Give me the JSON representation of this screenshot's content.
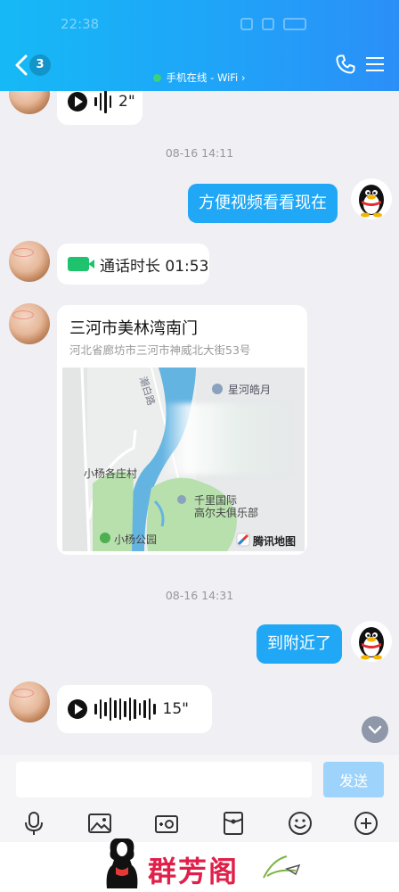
{
  "status_bar": {
    "time": "22:38"
  },
  "header": {
    "unread_count": "3",
    "online_status": "手机在线 - WiFi",
    "online_chevron": "›"
  },
  "messages": {
    "voice_1_duration": "2\"",
    "time_1": "08-16 14:11",
    "out_1": "方便视频看看现在",
    "call_text": "通话时长 01:53",
    "location_title": "三河市美林湾南门",
    "location_address": "河北省廊坊市三河市神威北大街53号",
    "map_labels": {
      "star": "星河皓月",
      "road": "潮白路",
      "village": "小杨各庄村",
      "golf_1": "千里国际",
      "golf_2": "高尔夫俱乐部",
      "park": "小杨公园",
      "provider": "腾讯地图"
    },
    "time_2": "08-16 14:31",
    "out_2": "到附近了",
    "voice_2_duration": "15\""
  },
  "input": {
    "placeholder": "",
    "send_label": "发送"
  },
  "toolbar_icons": [
    "microphone-icon",
    "image-icon",
    "camera-icon",
    "red-packet-icon",
    "emoji-icon",
    "plus-icon"
  ],
  "watermark": {
    "text": "群芳阁"
  },
  "colors": {
    "header": "#1ea6f8",
    "bubble_out": "#20a8f6",
    "send_disabled": "#9ed4fb",
    "video_icon": "#1fc36e"
  }
}
